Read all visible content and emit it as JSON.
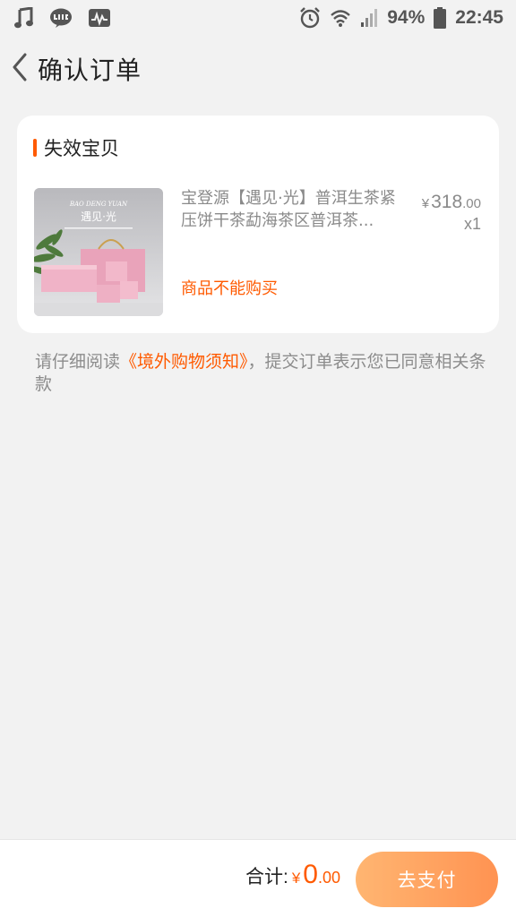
{
  "status_bar": {
    "left_icons": [
      "music-note-icon",
      "line-app-icon",
      "pulse-monitor-icon"
    ],
    "right_icons": [
      "alarm-clock-icon",
      "wifi-icon",
      "cell-signal-icon",
      "battery-icon"
    ],
    "battery": "94%",
    "time": "22:45"
  },
  "header": {
    "back_icon": "chevron-left-icon",
    "title": "确认订单"
  },
  "card": {
    "section_title": "失效宝贝",
    "accent_color": "#ff5a00",
    "product": {
      "image_text": {
        "brand_en": "BAO DENG YUAN",
        "brand_cn": "遇见·光"
      },
      "title": "宝登源【遇见·光】普洱生茶紧压饼干茶勐海茶区普洱茶...",
      "price_currency": "¥",
      "price_int": "318",
      "price_dec": ".00",
      "quantity": "x1",
      "status": "商品不能购买"
    }
  },
  "notice": {
    "prefix": "请仔细阅读",
    "link": "《境外购物须知》",
    "suffix": "，提交订单表示您已同意相关条款"
  },
  "bottom_bar": {
    "total_label": "合计:",
    "total_currency": "¥",
    "total_int": "0",
    "total_dec": ".00",
    "pay_button": "去支付",
    "pay_button_state": "disabled"
  }
}
